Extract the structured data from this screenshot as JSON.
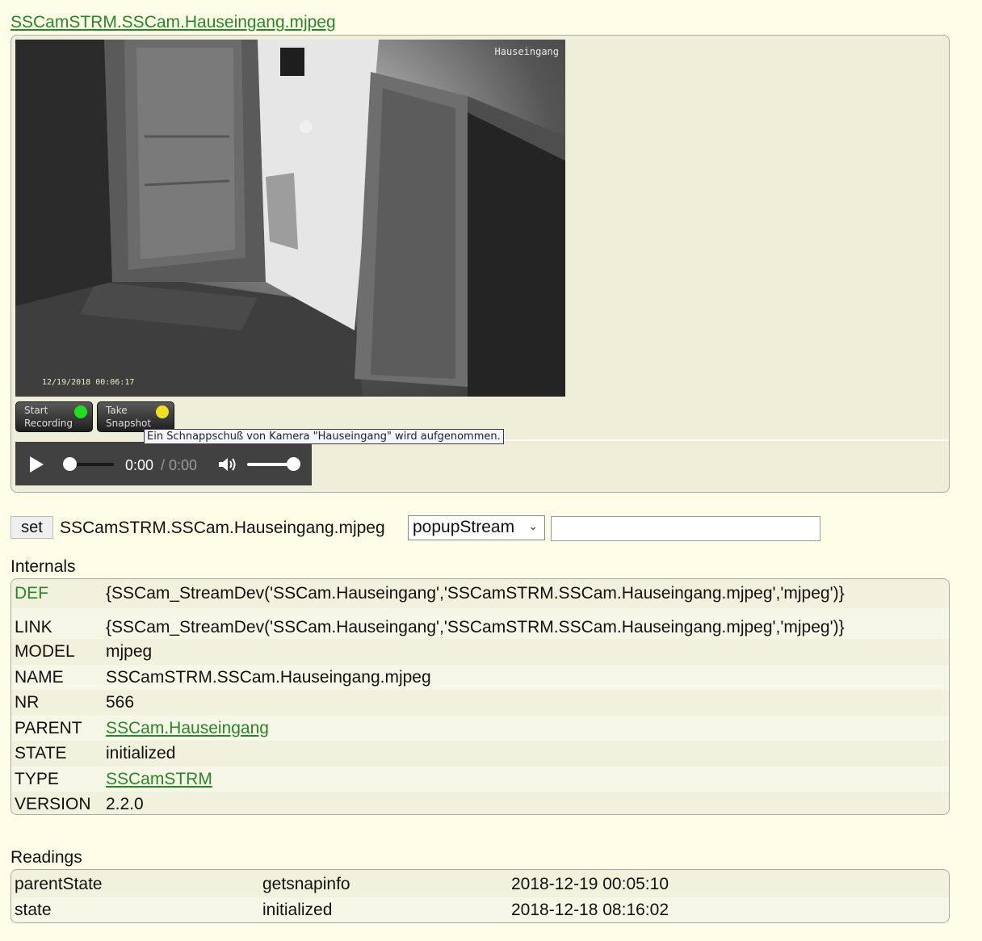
{
  "device_link": "SSCamSTRM.SSCam.Hauseingang.mjpeg",
  "stream": {
    "camera_label": "Hauseingang",
    "camera_timestamp": "12/19/2018  00:06:17",
    "buttons": {
      "record": {
        "line1": "Start",
        "line2": "Recording",
        "led_color": "#22dd22"
      },
      "snapshot": {
        "line1": "Take",
        "line2": "Snapshot",
        "led_color": "#f0e020"
      }
    },
    "tooltip": "Ein Schnappschuß von Kamera \"Hauseingang\" wird aufgenommen.",
    "audio": {
      "current_time": "0:00",
      "separator_duration": "/ 0:00",
      "progress": 0,
      "volume": 1.0
    }
  },
  "set_row": {
    "button_label": "set",
    "device_name": "SSCamSTRM.SSCam.Hauseingang.mjpeg",
    "command_selected": "popupStream",
    "value_input": ""
  },
  "internals": {
    "heading": "Internals",
    "rows": [
      {
        "key": "DEF",
        "value": "{SSCam_StreamDev('SSCam.Hauseingang','SSCamSTRM.SSCam.Hauseingang.mjpeg','mjpeg')}"
      },
      {
        "key": "LINK",
        "value": "{SSCam_StreamDev('SSCam.Hauseingang','SSCamSTRM.SSCam.Hauseingang.mjpeg','mjpeg')}"
      },
      {
        "key": "MODEL",
        "value": "mjpeg"
      },
      {
        "key": "NAME",
        "value": "SSCamSTRM.SSCam.Hauseingang.mjpeg"
      },
      {
        "key": "NR",
        "value": "566"
      },
      {
        "key": "PARENT",
        "value": "SSCam.Hauseingang"
      },
      {
        "key": "STATE",
        "value": "initialized"
      },
      {
        "key": "TYPE",
        "value": "SSCamSTRM"
      },
      {
        "key": "VERSION",
        "value": "2.2.0"
      }
    ]
  },
  "readings": {
    "heading": "Readings",
    "rows": [
      {
        "name": "parentState",
        "value": "getsnapinfo",
        "time": "2018-12-19 00:05:10"
      },
      {
        "name": "state",
        "value": "initialized",
        "time": "2018-12-18 08:16:02"
      }
    ]
  },
  "colors": {
    "background": "#fefee8",
    "link": "#278727",
    "panel": "#efeed8"
  }
}
